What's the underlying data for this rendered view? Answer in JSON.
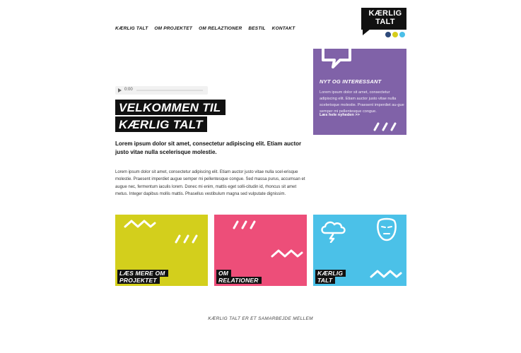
{
  "nav": {
    "items": [
      "KÆRLIG TALT",
      "OM PROJEKTET",
      "OM RELAZTIONER",
      "BESTIL",
      "KONTAKT"
    ]
  },
  "logo": {
    "line1": "KÆRLIG",
    "line2": "TALT"
  },
  "social": {
    "icons": [
      "circle-icon-navy",
      "circle-icon-yellow",
      "circle-icon-cyan"
    ],
    "colors": [
      "#2e4a7a",
      "#d6cd1c",
      "#4bbfe8"
    ]
  },
  "audio": {
    "time": "0:00"
  },
  "main": {
    "title_line1": "VELKOMMEN TIL",
    "title_line2": "KÆRLIG TALT",
    "lead": "Lorem ipsum dolor sit amet, consectetur adipiscing elit. Etiam auctor justo vitae nulla scelerisque molestie.",
    "body": "Lorem ipsum dolor sit amet, consectetur adipiscing elit. Etiam auctor justo vitae nulla scel-erisque molestie. Praesent imperdiet augue semper mi pellentesque congue. Sed massa purus, accumsan et augue nec, fermentum iaculis lorem. Donec mi enim, mattis eget solli-citudin id, rhoncus sit amet metus. Integer dapibus mollis mattis. Phasellus vestibulum magna sed vulputate dignissim."
  },
  "news": {
    "heading": "NYT OG INTERESSANT",
    "text": "Lorem ipsum dolor sit amet, consectetur adipiscing elit. Etiam auctor justo vitae nulla scelerisque molestie. Praesent imperdiet au-gue semper mi pellentesque congue.",
    "link": "Læs hele nyheden >>",
    "color": "#8062a8"
  },
  "tiles": [
    {
      "label_line1": "LÆS MERE OM",
      "label_line2": "PROJEKTET",
      "color": "#d3cf1c"
    },
    {
      "label_line1": "OM",
      "label_line2": "RELATIONER",
      "color": "#ed4e79"
    },
    {
      "label_line1": "KÆRLIG",
      "label_line2": "TALT",
      "color": "#4bc1e8"
    }
  ],
  "footer": {
    "text": "KÆRLIG TALT ER ET SAMARBEJDE MELLEM"
  }
}
